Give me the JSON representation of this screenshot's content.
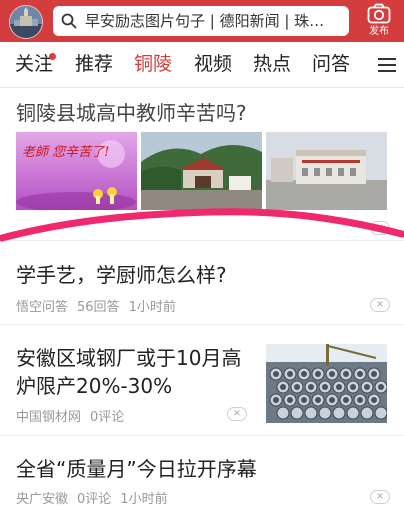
{
  "header": {
    "search_text": "早安励志图片句子 | 德阳新闻 | 珠…",
    "publish_label": "发布"
  },
  "tabs": [
    {
      "label": "关注",
      "has_dot": true
    },
    {
      "label": "推荐"
    },
    {
      "label": "铜陵",
      "active": true
    },
    {
      "label": "视频"
    },
    {
      "label": "热点"
    },
    {
      "label": "问答"
    }
  ],
  "feed": {
    "items": [
      {
        "title": "铜陵县城高中教师辛苦吗?",
        "images": [
          {
            "label": "teacher-greeting-card",
            "caption": "老師 您辛苦了!"
          },
          {
            "label": "school-gate-photo"
          },
          {
            "label": "school-building-photo"
          }
        ]
      },
      {
        "title": "学手艺，学厨师怎么样?",
        "source": "悟空问答",
        "answers": "56回答",
        "time": "1小时前"
      },
      {
        "title_line1": "安徽区域钢厂或于10月高",
        "title_line2": "炉限产20%-30%",
        "source": "中国钢材网",
        "comments": "0评论",
        "image": {
          "label": "steel-pipes-photo"
        }
      },
      {
        "title": "全省“质量月”今日拉开序幕",
        "source": "央广安徽",
        "comments": "0评论",
        "time": "1小时前"
      }
    ]
  },
  "colors": {
    "brand_red": "#d43d3d",
    "annotation_pink": "#f0286e"
  }
}
